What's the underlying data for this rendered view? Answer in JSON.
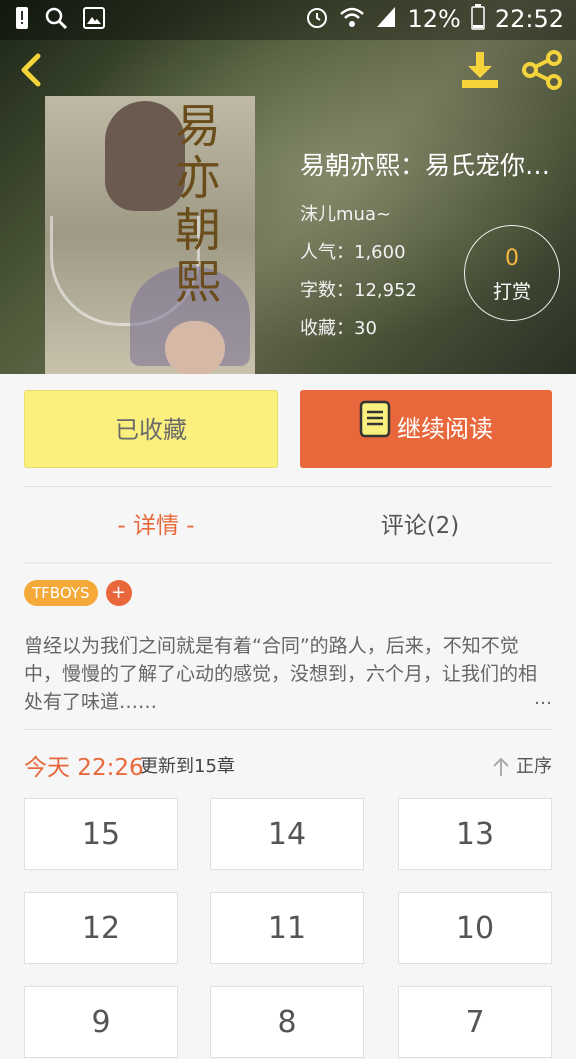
{
  "status_bar": {
    "battery_percent": "12%",
    "time": "22:52"
  },
  "book": {
    "cover_chars": [
      "易",
      "亦",
      "朝",
      "熙"
    ],
    "title": "易朝亦熙：易氏宠你…",
    "author": "沫儿mua~",
    "popularity": "人气：1,600",
    "word_count": "字数：12,952",
    "favorites": "收藏：30",
    "reward_count": "0",
    "reward_label": "打赏"
  },
  "actions": {
    "collected_label": "已收藏",
    "read_label": "继续阅读"
  },
  "tabs": {
    "detail_label": "- 详情 -",
    "comments_label": "评论(2)"
  },
  "tags": [
    "TFBOYS"
  ],
  "tag_add": "+",
  "description": {
    "text": "曾经以为我们之间就是有着“合同”的路人，后来，不知不觉中，慢慢的了解了心动的感觉，没想到，六个月，让我们的相处有了味道……",
    "more": "…"
  },
  "update": {
    "time": "今天 22:26",
    "text": "更新到15章",
    "sort_label": "正序"
  },
  "chapters": [
    "15",
    "14",
    "13",
    "12",
    "11",
    "10",
    "9",
    "8",
    "7"
  ],
  "colors": {
    "accent": "#e8683b",
    "collected_bg": "#fbef7d",
    "tag": "#f5a938",
    "toolbar_icon": "#f5d33b"
  }
}
